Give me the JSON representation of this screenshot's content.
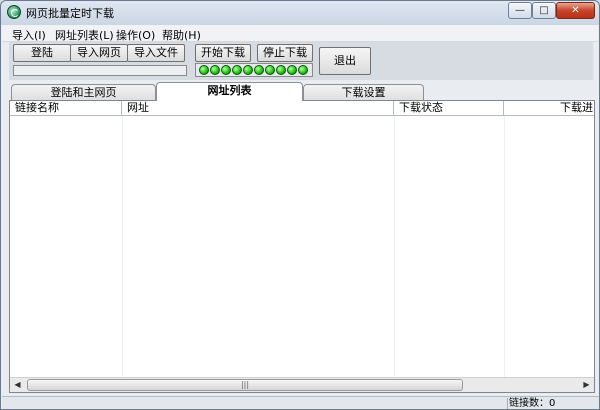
{
  "window": {
    "title": "网页批量定时下载",
    "controls": {
      "minimize": "—",
      "maximize": "□",
      "close": "✕"
    }
  },
  "menubar": {
    "items": [
      "导入(I)",
      "网址列表(L)",
      "操作(O)",
      "帮助(H)"
    ]
  },
  "toolbar": {
    "login": "登陆",
    "import_page": "导入网页",
    "import_file": "导入文件",
    "start_download": "开始下载",
    "stop_download": "停止下载",
    "exit": "退出",
    "led_count": 10,
    "led_color": "#22c414"
  },
  "tabs": {
    "items": [
      "登陆和主网页",
      "网址列表",
      "下载设置"
    ],
    "active": 1
  },
  "table": {
    "columns": [
      "链接名称",
      "网址",
      "下载状态",
      "下载进"
    ],
    "rows": []
  },
  "scrollbar": {
    "left": "◀",
    "right": "▶",
    "grip": "|||"
  },
  "statusbar": {
    "text": "链接数：0"
  }
}
